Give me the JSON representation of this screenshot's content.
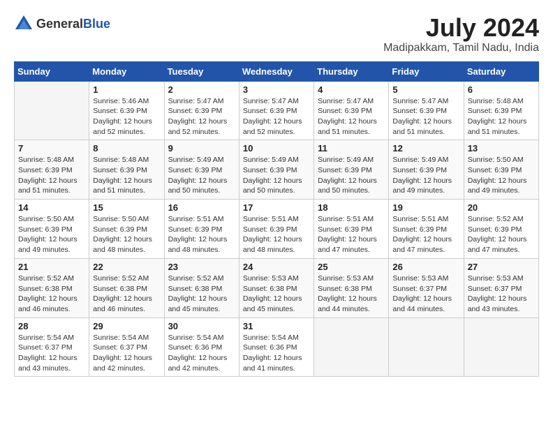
{
  "logo": {
    "text_general": "General",
    "text_blue": "Blue"
  },
  "title": "July 2024",
  "subtitle": "Madipakkam, Tamil Nadu, India",
  "header_days": [
    "Sunday",
    "Monday",
    "Tuesday",
    "Wednesday",
    "Thursday",
    "Friday",
    "Saturday"
  ],
  "weeks": [
    [
      {
        "day": "",
        "info": ""
      },
      {
        "day": "1",
        "info": "Sunrise: 5:46 AM\nSunset: 6:39 PM\nDaylight: 12 hours\nand 52 minutes."
      },
      {
        "day": "2",
        "info": "Sunrise: 5:47 AM\nSunset: 6:39 PM\nDaylight: 12 hours\nand 52 minutes."
      },
      {
        "day": "3",
        "info": "Sunrise: 5:47 AM\nSunset: 6:39 PM\nDaylight: 12 hours\nand 52 minutes."
      },
      {
        "day": "4",
        "info": "Sunrise: 5:47 AM\nSunset: 6:39 PM\nDaylight: 12 hours\nand 51 minutes."
      },
      {
        "day": "5",
        "info": "Sunrise: 5:47 AM\nSunset: 6:39 PM\nDaylight: 12 hours\nand 51 minutes."
      },
      {
        "day": "6",
        "info": "Sunrise: 5:48 AM\nSunset: 6:39 PM\nDaylight: 12 hours\nand 51 minutes."
      }
    ],
    [
      {
        "day": "7",
        "info": "Sunrise: 5:48 AM\nSunset: 6:39 PM\nDaylight: 12 hours\nand 51 minutes."
      },
      {
        "day": "8",
        "info": "Sunrise: 5:48 AM\nSunset: 6:39 PM\nDaylight: 12 hours\nand 51 minutes."
      },
      {
        "day": "9",
        "info": "Sunrise: 5:49 AM\nSunset: 6:39 PM\nDaylight: 12 hours\nand 50 minutes."
      },
      {
        "day": "10",
        "info": "Sunrise: 5:49 AM\nSunset: 6:39 PM\nDaylight: 12 hours\nand 50 minutes."
      },
      {
        "day": "11",
        "info": "Sunrise: 5:49 AM\nSunset: 6:39 PM\nDaylight: 12 hours\nand 50 minutes."
      },
      {
        "day": "12",
        "info": "Sunrise: 5:49 AM\nSunset: 6:39 PM\nDaylight: 12 hours\nand 49 minutes."
      },
      {
        "day": "13",
        "info": "Sunrise: 5:50 AM\nSunset: 6:39 PM\nDaylight: 12 hours\nand 49 minutes."
      }
    ],
    [
      {
        "day": "14",
        "info": "Sunrise: 5:50 AM\nSunset: 6:39 PM\nDaylight: 12 hours\nand 49 minutes."
      },
      {
        "day": "15",
        "info": "Sunrise: 5:50 AM\nSunset: 6:39 PM\nDaylight: 12 hours\nand 48 minutes."
      },
      {
        "day": "16",
        "info": "Sunrise: 5:51 AM\nSunset: 6:39 PM\nDaylight: 12 hours\nand 48 minutes."
      },
      {
        "day": "17",
        "info": "Sunrise: 5:51 AM\nSunset: 6:39 PM\nDaylight: 12 hours\nand 48 minutes."
      },
      {
        "day": "18",
        "info": "Sunrise: 5:51 AM\nSunset: 6:39 PM\nDaylight: 12 hours\nand 47 minutes."
      },
      {
        "day": "19",
        "info": "Sunrise: 5:51 AM\nSunset: 6:39 PM\nDaylight: 12 hours\nand 47 minutes."
      },
      {
        "day": "20",
        "info": "Sunrise: 5:52 AM\nSunset: 6:39 PM\nDaylight: 12 hours\nand 47 minutes."
      }
    ],
    [
      {
        "day": "21",
        "info": "Sunrise: 5:52 AM\nSunset: 6:38 PM\nDaylight: 12 hours\nand 46 minutes."
      },
      {
        "day": "22",
        "info": "Sunrise: 5:52 AM\nSunset: 6:38 PM\nDaylight: 12 hours\nand 46 minutes."
      },
      {
        "day": "23",
        "info": "Sunrise: 5:52 AM\nSunset: 6:38 PM\nDaylight: 12 hours\nand 45 minutes."
      },
      {
        "day": "24",
        "info": "Sunrise: 5:53 AM\nSunset: 6:38 PM\nDaylight: 12 hours\nand 45 minutes."
      },
      {
        "day": "25",
        "info": "Sunrise: 5:53 AM\nSunset: 6:38 PM\nDaylight: 12 hours\nand 44 minutes."
      },
      {
        "day": "26",
        "info": "Sunrise: 5:53 AM\nSunset: 6:37 PM\nDaylight: 12 hours\nand 44 minutes."
      },
      {
        "day": "27",
        "info": "Sunrise: 5:53 AM\nSunset: 6:37 PM\nDaylight: 12 hours\nand 43 minutes."
      }
    ],
    [
      {
        "day": "28",
        "info": "Sunrise: 5:54 AM\nSunset: 6:37 PM\nDaylight: 12 hours\nand 43 minutes."
      },
      {
        "day": "29",
        "info": "Sunrise: 5:54 AM\nSunset: 6:37 PM\nDaylight: 12 hours\nand 42 minutes."
      },
      {
        "day": "30",
        "info": "Sunrise: 5:54 AM\nSunset: 6:36 PM\nDaylight: 12 hours\nand 42 minutes."
      },
      {
        "day": "31",
        "info": "Sunrise: 5:54 AM\nSunset: 6:36 PM\nDaylight: 12 hours\nand 41 minutes."
      },
      {
        "day": "",
        "info": ""
      },
      {
        "day": "",
        "info": ""
      },
      {
        "day": "",
        "info": ""
      }
    ]
  ]
}
